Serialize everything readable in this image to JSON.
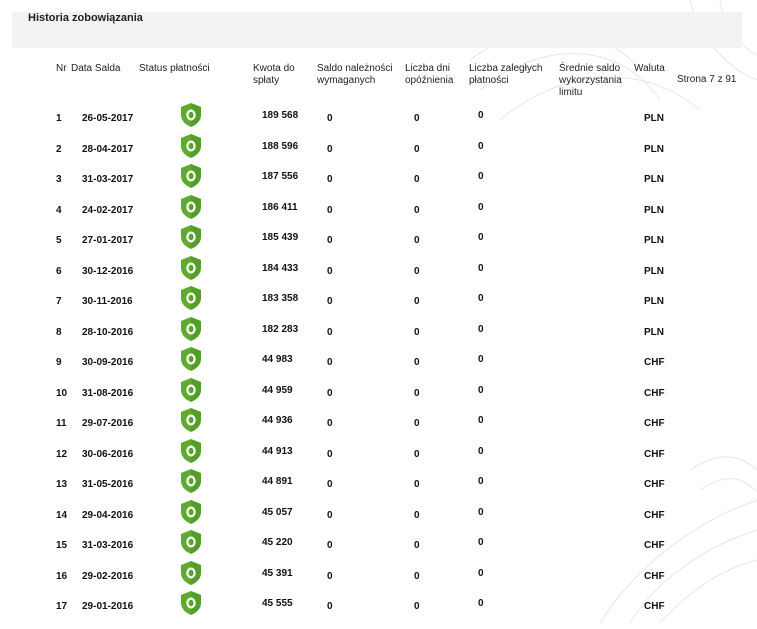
{
  "section": {
    "title": "Historia zobowiązania"
  },
  "columns": {
    "nr": "Nr",
    "date": "Data Salda",
    "status": "Status płatności",
    "amount": [
      "Kwota do",
      "spłaty"
    ],
    "balance_due": [
      "Saldo należności",
      "wymaganych"
    ],
    "days_late": [
      "Liczba dni",
      "opóźnienia"
    ],
    "overdue_payments": [
      "Liczba zaległych",
      "płatności"
    ],
    "avg_limit": [
      "Średnie saldo",
      "wykorzystania",
      "limitu"
    ],
    "currency": "Waluta"
  },
  "page_indicator": "Strona 7 z 91",
  "status_icon": "green-shield-icon",
  "colors": {
    "shield": "#5faa2f",
    "shield_dark": "#3f8a1f",
    "header_bg": "#f2f2f2"
  },
  "rows": [
    {
      "nr": "1",
      "date": "26-05-2017",
      "amount": "189 568",
      "balance": "0",
      "days": "0",
      "overdue": "0",
      "currency": "PLN"
    },
    {
      "nr": "2",
      "date": "28-04-2017",
      "amount": "188 596",
      "balance": "0",
      "days": "0",
      "overdue": "0",
      "currency": "PLN"
    },
    {
      "nr": "3",
      "date": "31-03-2017",
      "amount": "187 556",
      "balance": "0",
      "days": "0",
      "overdue": "0",
      "currency": "PLN"
    },
    {
      "nr": "4",
      "date": "24-02-2017",
      "amount": "186 411",
      "balance": "0",
      "days": "0",
      "overdue": "0",
      "currency": "PLN"
    },
    {
      "nr": "5",
      "date": "27-01-2017",
      "amount": "185 439",
      "balance": "0",
      "days": "0",
      "overdue": "0",
      "currency": "PLN"
    },
    {
      "nr": "6",
      "date": "30-12-2016",
      "amount": "184 433",
      "balance": "0",
      "days": "0",
      "overdue": "0",
      "currency": "PLN"
    },
    {
      "nr": "7",
      "date": "30-11-2016",
      "amount": "183 358",
      "balance": "0",
      "days": "0",
      "overdue": "0",
      "currency": "PLN"
    },
    {
      "nr": "8",
      "date": "28-10-2016",
      "amount": "182 283",
      "balance": "0",
      "days": "0",
      "overdue": "0",
      "currency": "PLN"
    },
    {
      "nr": "9",
      "date": "30-09-2016",
      "amount": "44 983",
      "balance": "0",
      "days": "0",
      "overdue": "0",
      "currency": "CHF"
    },
    {
      "nr": "10",
      "date": "31-08-2016",
      "amount": "44 959",
      "balance": "0",
      "days": "0",
      "overdue": "0",
      "currency": "CHF"
    },
    {
      "nr": "11",
      "date": "29-07-2016",
      "amount": "44 936",
      "balance": "0",
      "days": "0",
      "overdue": "0",
      "currency": "CHF"
    },
    {
      "nr": "12",
      "date": "30-06-2016",
      "amount": "44 913",
      "balance": "0",
      "days": "0",
      "overdue": "0",
      "currency": "CHF"
    },
    {
      "nr": "13",
      "date": "31-05-2016",
      "amount": "44 891",
      "balance": "0",
      "days": "0",
      "overdue": "0",
      "currency": "CHF"
    },
    {
      "nr": "14",
      "date": "29-04-2016",
      "amount": "45 057",
      "balance": "0",
      "days": "0",
      "overdue": "0",
      "currency": "CHF"
    },
    {
      "nr": "15",
      "date": "31-03-2016",
      "amount": "45 220",
      "balance": "0",
      "days": "0",
      "overdue": "0",
      "currency": "CHF"
    },
    {
      "nr": "16",
      "date": "29-02-2016",
      "amount": "45 391",
      "balance": "0",
      "days": "0",
      "overdue": "0",
      "currency": "CHF"
    },
    {
      "nr": "17",
      "date": "29-01-2016",
      "amount": "45 555",
      "balance": "0",
      "days": "0",
      "overdue": "0",
      "currency": "CHF"
    }
  ]
}
